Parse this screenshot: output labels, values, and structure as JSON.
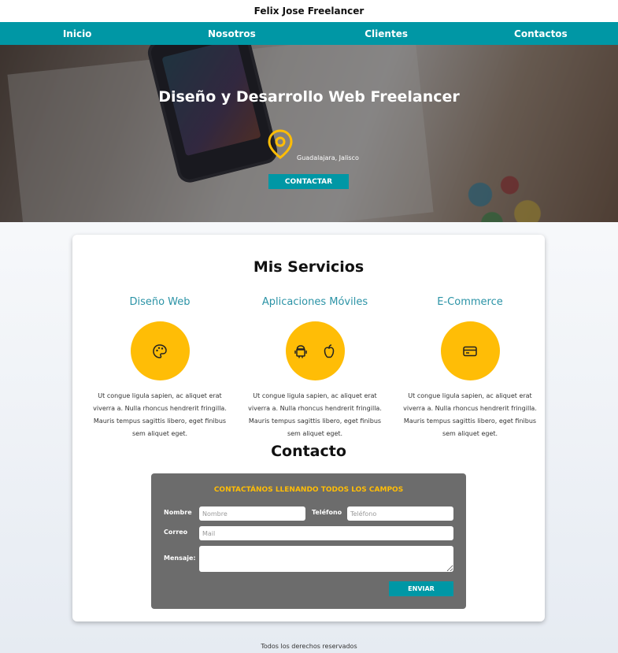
{
  "site": {
    "title": "Felix Jose Freelancer"
  },
  "nav": {
    "items": [
      "Inicio",
      "Nosotros",
      "Clientes",
      "Contactos"
    ]
  },
  "hero": {
    "title": "Diseño y Desarrollo Web Freelancer",
    "location": "Guadalajara, Jalisco",
    "button": "CONTACTAR",
    "pin_icon": "map-pin-icon",
    "accent": "#ffbd06"
  },
  "services": {
    "title": "Mis Servicios",
    "items": [
      {
        "title": "Diseño Web",
        "icons": [
          "palette-icon"
        ],
        "text": "Ut congue ligula sapien, ac aliquet erat viverra a. Nulla rhoncus hendrerit fringilla. Mauris tempus sagittis libero, eget finibus sem aliquet eget."
      },
      {
        "title": "Aplicaciones Móviles",
        "icons": [
          "android-icon",
          "apple-icon"
        ],
        "text": "Ut congue ligula sapien, ac aliquet erat viverra a. Nulla rhoncus hendrerit fringilla. Mauris tempus sagittis libero, eget finibus sem aliquet eget."
      },
      {
        "title": "E-Commerce",
        "icons": [
          "credit-card-icon"
        ],
        "text": "Ut congue ligula sapien, ac aliquet erat viverra a. Nulla rhoncus hendrerit fringilla. Mauris tempus sagittis libero, eget finibus sem aliquet eget."
      }
    ]
  },
  "contact": {
    "title": "Contacto",
    "heading": "CONTACTÁNOS LLENANDO TODOS LOS CAMPOS",
    "name_label": "Nombre",
    "name_placeholder": "Nombre",
    "phone_label": "Teléfono",
    "phone_placeholder": "Teléfono",
    "email_label": "Correo",
    "email_placeholder": "Mail",
    "message_label": "Mensaje:",
    "send_button": "ENVIAR"
  },
  "footer": {
    "text": "Todos los derechos reservados"
  },
  "colors": {
    "primary": "#0097a5",
    "accent": "#ffbd06",
    "form_bg": "#6c6c6c",
    "service_title": "#2b93a6"
  }
}
